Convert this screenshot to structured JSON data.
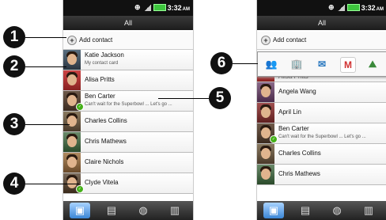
{
  "status": {
    "time": "3:32",
    "ampm": "AM"
  },
  "title": "All",
  "add_contact": "Add contact",
  "left_contacts": [
    {
      "name": "Katie Jackson",
      "sub": "My contact card"
    },
    {
      "name": "Alisa Pritts"
    },
    {
      "name": "Ben  Carter",
      "sub": "Can't wait for the Superbowl ... Let's go ..."
    },
    {
      "name": "Charles  Collins"
    },
    {
      "name": "Chris Mathews"
    },
    {
      "name": "Claire Nichols"
    },
    {
      "name": "Clyde Vitela"
    }
  ],
  "right_contacts": [
    {
      "name": "Alisa Pritts"
    },
    {
      "name": "Angela Wang"
    },
    {
      "name": "April  Lin"
    },
    {
      "name": "Ben  Carter",
      "sub": "Can't wait for the Superbowl ... Let's go ..."
    },
    {
      "name": "Charles  Collins"
    },
    {
      "name": "Chris Mathews"
    }
  ],
  "callouts": [
    "1",
    "2",
    "3",
    "4",
    "5",
    "6"
  ],
  "favorites_bar": [
    "people-icon",
    "office-icon",
    "email-icon",
    "gmail-icon",
    "map-icon"
  ],
  "favorite_glyphs": {
    "people": "👥",
    "office": "🏢",
    "email": "✉",
    "gmail": "M",
    "map": "⛰"
  },
  "tabs": [
    "people-tab-icon",
    "groups-tab-icon",
    "online-tab-icon",
    "call-log-tab-icon"
  ],
  "colors": {
    "accent": "#3b86d6",
    "presence": "#44b018",
    "statusbar": "#111111"
  }
}
